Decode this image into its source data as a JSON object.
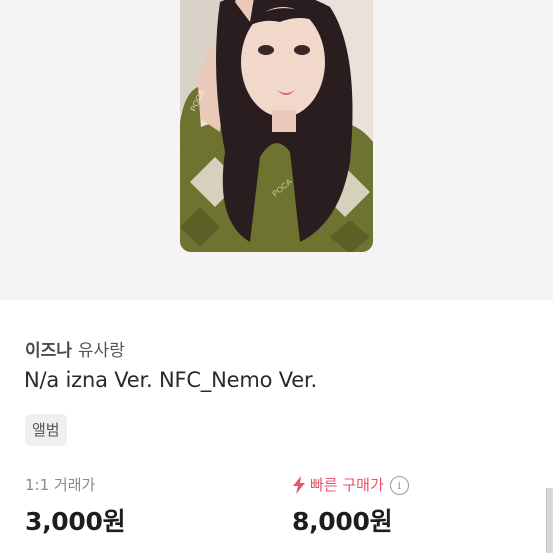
{
  "product": {
    "group": "이즈나",
    "member": "유사랑",
    "title": "N/a izna Ver. NFC_Nemo Ver.",
    "tag": "앨범",
    "image_icon": "photocard-image"
  },
  "pricing": {
    "trade_label": "1:1 거래가",
    "trade_price": "3,000원",
    "fast_label": "빠른 구매가",
    "fast_price": "8,000원",
    "fast_icon": "lightning-bolt-icon",
    "info_icon": "info-circle-icon",
    "fast_color": "#e8536b"
  },
  "watermark": "POCA"
}
